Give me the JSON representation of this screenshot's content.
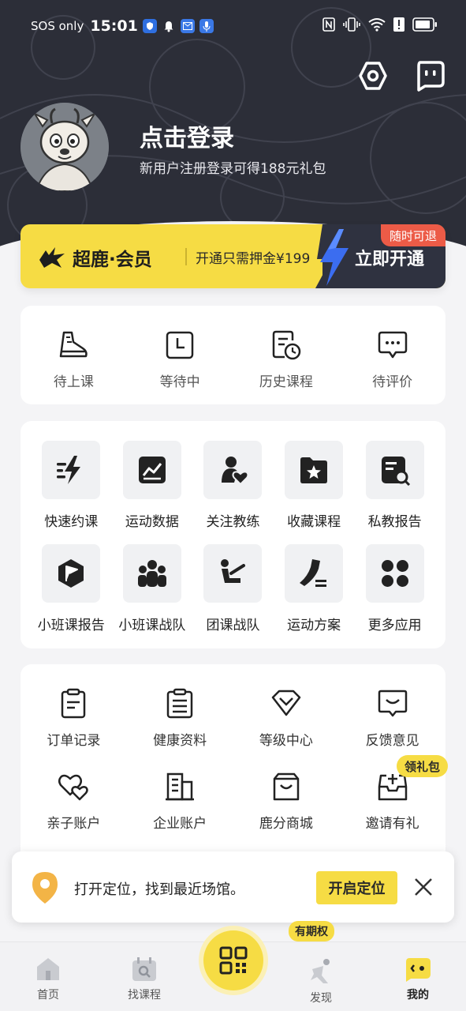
{
  "status": {
    "carrier": "SOS only",
    "time": "15:01"
  },
  "profile": {
    "login_title": "点击登录",
    "login_subtitle": "新用户注册登录可得188元礼包"
  },
  "member": {
    "brand": "超鹿·会员",
    "deposit_text": "开通只需押金¥199",
    "open_label": "立即开通",
    "refund_badge": "随时可退"
  },
  "course_status": [
    {
      "label": "待上课",
      "icon": "sneaker-icon"
    },
    {
      "label": "等待中",
      "icon": "clock-icon"
    },
    {
      "label": "历史课程",
      "icon": "history-icon"
    },
    {
      "label": "待评价",
      "icon": "comment-icon"
    }
  ],
  "apps_row1": [
    {
      "label": "快速约课",
      "icon": "fast-book-icon"
    },
    {
      "label": "运动数据",
      "icon": "chart-icon"
    },
    {
      "label": "关注教练",
      "icon": "coach-heart-icon"
    },
    {
      "label": "收藏课程",
      "icon": "folder-star-icon"
    },
    {
      "label": "私教报告",
      "icon": "report-search-icon"
    }
  ],
  "apps_row2": [
    {
      "label": "小班课报告",
      "icon": "flag-shield-icon"
    },
    {
      "label": "小班课战队",
      "icon": "team-icon"
    },
    {
      "label": "团课战队",
      "icon": "workout-icon"
    },
    {
      "label": "运动方案",
      "icon": "shoe-plan-icon"
    },
    {
      "label": "更多应用",
      "icon": "more-apps-icon"
    }
  ],
  "services_row1": [
    {
      "label": "订单记录",
      "icon": "clipboard-icon"
    },
    {
      "label": "健康资料",
      "icon": "document-icon"
    },
    {
      "label": "等级中心",
      "icon": "diamond-icon"
    },
    {
      "label": "反馈意见",
      "icon": "feedback-icon"
    }
  ],
  "services_row2": [
    {
      "label": "亲子账户",
      "icon": "hearts-icon"
    },
    {
      "label": "企业账户",
      "icon": "building-icon"
    },
    {
      "label": "鹿分商城",
      "icon": "shopping-bag-icon"
    },
    {
      "label": "邀请有礼",
      "icon": "gift-box-icon"
    }
  ],
  "gift_badge": "领礼包",
  "location_bar": {
    "text": "打开定位，找到最近场馆。",
    "button": "开启定位"
  },
  "bottom_nav": {
    "home": "首页",
    "find_course": "找课程",
    "discover": "发现",
    "mine": "我的",
    "period_badge": "有期权"
  },
  "colors": {
    "accent_yellow": "#f6dc44",
    "dark": "#2c2e38",
    "badge_red": "#ec5b47"
  }
}
